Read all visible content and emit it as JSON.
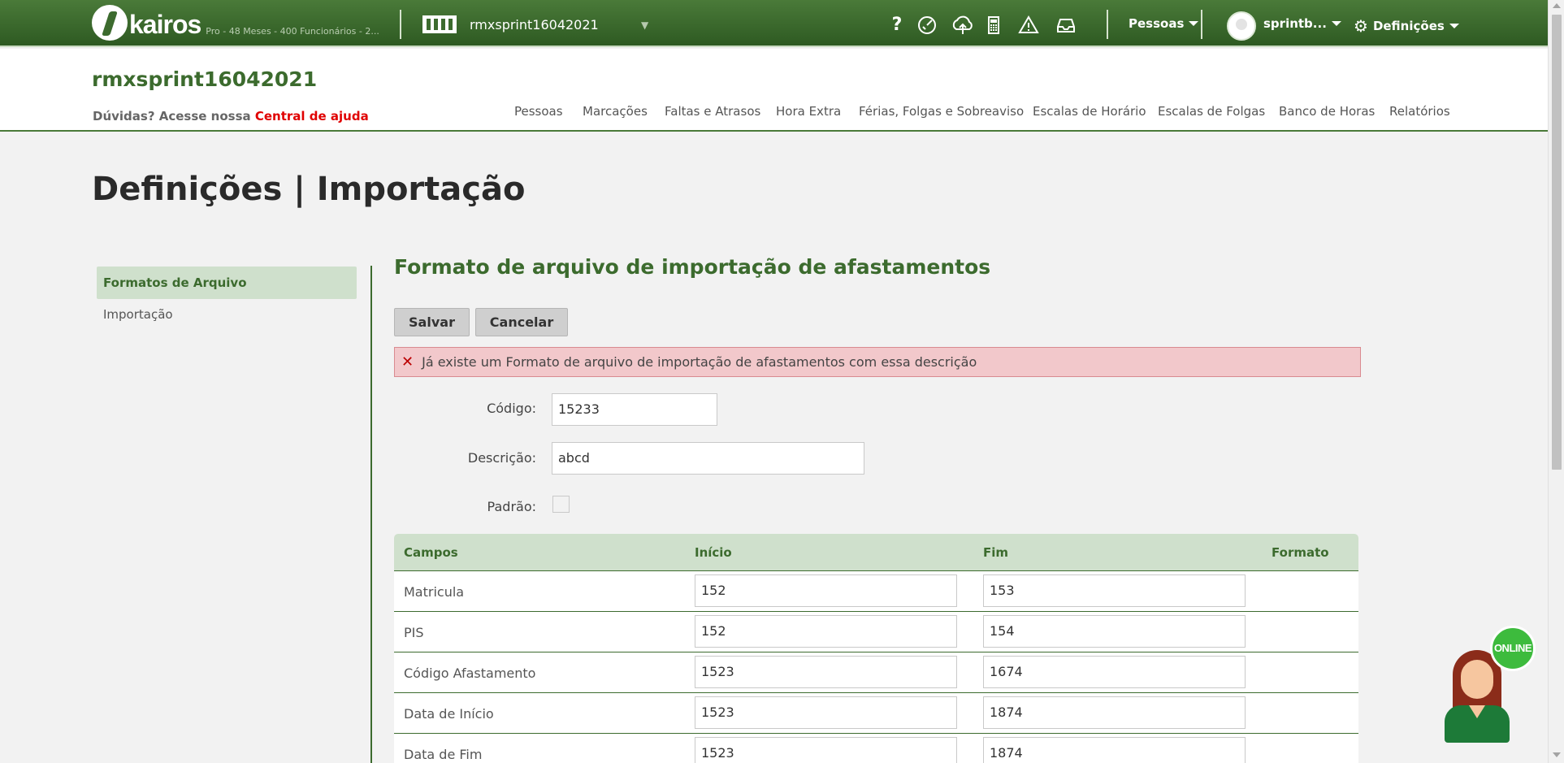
{
  "topbar": {
    "logo_text": "kairos",
    "logo_sub": "Pro - 48 Meses - 400 Funcionários - 2...",
    "company": "rmxsprint16042021",
    "icons": [
      "help-icon",
      "timer-icon",
      "cloud-upload-icon",
      "calculator-icon",
      "warning-icon",
      "inbox-icon"
    ],
    "help_glyph": "?",
    "menu_people": "Pessoas",
    "user": "sprintb...",
    "menu_settings": "Definições"
  },
  "header": {
    "title": "rmxsprint16042021",
    "help_text": "Dúvidas? Acesse nossa ",
    "help_link": "Central de ajuda",
    "nav": [
      "Pessoas",
      "Marcações",
      "Faltas e Atrasos",
      "Hora Extra",
      "Férias, Folgas e Sobreaviso",
      "Escalas de Horário",
      "Escalas de Folgas",
      "Banco de Horas",
      "Relatórios"
    ]
  },
  "page": {
    "title": "Definições | Importação"
  },
  "sidebar": {
    "items": [
      {
        "label": "Formatos de Arquivo",
        "active": true
      },
      {
        "label": "Importação",
        "active": false
      }
    ]
  },
  "main": {
    "section_title": "Formato de arquivo de importação de afastamentos",
    "save_label": "Salvar",
    "cancel_label": "Cancelar",
    "alert": "Já existe um Formato de arquivo de importação de afastamentos com essa descrição",
    "alert_icon": "✕",
    "code_label": "Código:",
    "code_value": "15233",
    "description_label": "Descrição:",
    "description_value": "abcd",
    "default_label": "Padrão:",
    "default_checked": false
  },
  "table": {
    "headers": [
      "Campos",
      "Início",
      "Fim",
      "Formato"
    ],
    "rows": [
      {
        "field": "Matricula",
        "start": "152",
        "end": "153"
      },
      {
        "field": "PIS",
        "start": "152",
        "end": "154"
      },
      {
        "field": "Código Afastamento",
        "start": "1523",
        "end": "1674"
      },
      {
        "field": "Data de Início",
        "start": "1523",
        "end": "1874"
      },
      {
        "field": "Data de Fim",
        "start": "1523",
        "end": "1874"
      }
    ]
  },
  "chat": {
    "status": "ONLINE"
  }
}
